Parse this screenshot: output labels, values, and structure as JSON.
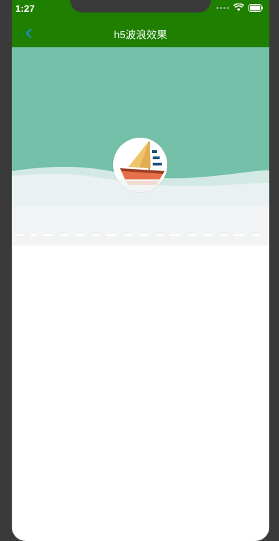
{
  "status_bar": {
    "time": "1:27"
  },
  "nav": {
    "title": "h5波浪效果"
  },
  "icons": {
    "back": "chevron-left-icon",
    "wifi": "wifi-icon",
    "battery": "battery-icon",
    "signal": "signal-dots-icon",
    "boat": "sailboat-icon"
  },
  "colors": {
    "nav_bg": "#1e7f00",
    "sea": "#74c0a8",
    "wave_light": "#d3e9e4",
    "foam": "#f1f3f4",
    "back_icon": "#1e90d8"
  }
}
